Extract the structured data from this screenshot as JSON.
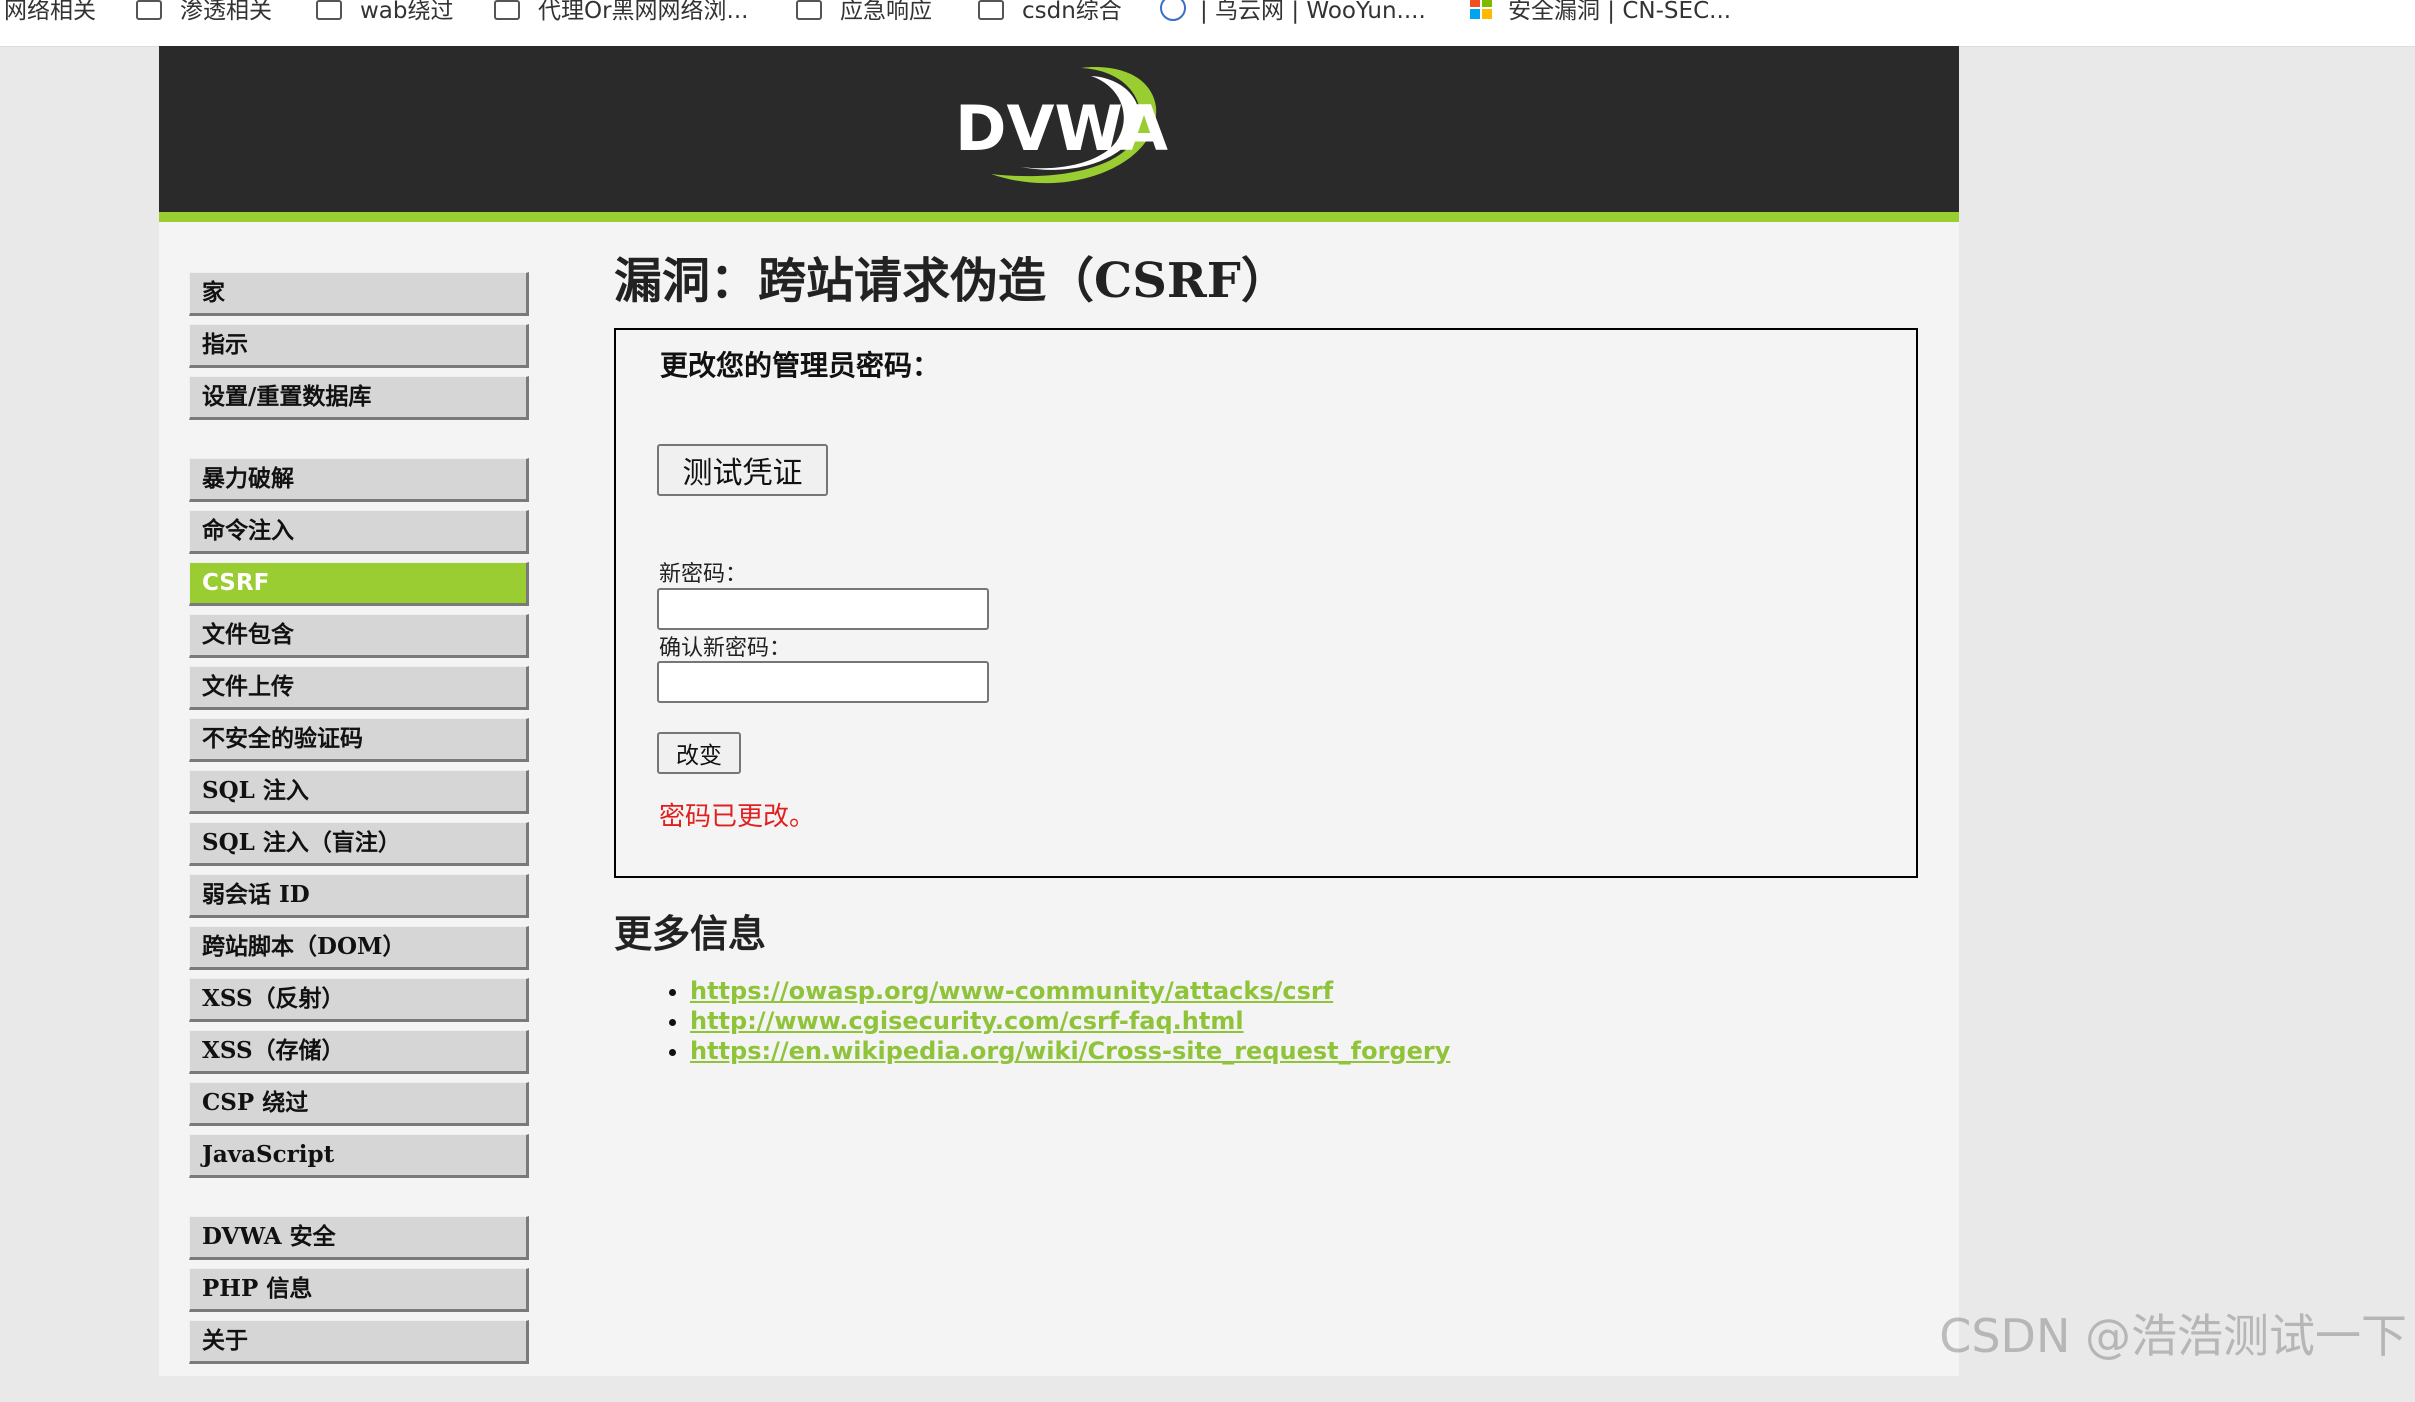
{
  "bookmarks": [
    {
      "label": "网络相关",
      "icon": "none"
    },
    {
      "label": "渗透相关",
      "icon": "folder-icon"
    },
    {
      "label": "wab绕过",
      "icon": "folder-icon"
    },
    {
      "label": "代理Or黑网网络浏...",
      "icon": "folder-icon"
    },
    {
      "label": "应急响应",
      "icon": "folder-icon"
    },
    {
      "label": "csdn综合",
      "icon": "folder-icon"
    },
    {
      "label": "| 乌云网 | WooYun....",
      "icon": "globe-icon"
    },
    {
      "label": "安全漏洞 | CN-SEC...",
      "icon": "grid-icon"
    }
  ],
  "header": {
    "logo_text": "DVWA",
    "accent_color": "#9acd32"
  },
  "menu": {
    "block1": [
      {
        "label": "家"
      },
      {
        "label": "指示"
      },
      {
        "label": "设置/重置数据库"
      }
    ],
    "block2": [
      {
        "label": "暴力破解"
      },
      {
        "label": "命令注入"
      },
      {
        "label": "CSRF",
        "selected": true
      },
      {
        "label": "文件包含"
      },
      {
        "label": "文件上传"
      },
      {
        "label": "不安全的验证码"
      },
      {
        "label": "SQL 注入"
      },
      {
        "label": "SQL 注入（盲注）"
      },
      {
        "label": "弱会话 ID"
      },
      {
        "label": "跨站脚本（DOM）"
      },
      {
        "label": "XSS（反射）"
      },
      {
        "label": "XSS（存储）"
      },
      {
        "label": "CSP 绕过"
      },
      {
        "label": "JavaScript"
      }
    ],
    "block3": [
      {
        "label": "DVWA 安全"
      },
      {
        "label": "PHP 信息"
      },
      {
        "label": "关于"
      }
    ]
  },
  "main": {
    "title": "漏洞：跨站请求伪造（CSRF）",
    "form": {
      "heading": "更改您的管理员密码：",
      "test_button": "测试凭证",
      "new_password_label": "新密码：",
      "new_password_value": "",
      "confirm_password_label": "确认新密码：",
      "confirm_password_value": "",
      "change_button": "改变",
      "message": "密码已更改。",
      "message_color": "#e0201f"
    },
    "more_info": {
      "title": "更多信息",
      "links": [
        "https://owasp.org/www-community/attacks/csrf",
        "http://www.cgisecurity.com/csrf-faq.html",
        "https://en.wikipedia.org/wiki/Cross-site_request_forgery"
      ],
      "link_color": "#8fc43a"
    }
  },
  "watermark": "CSDN @浩浩测试一下"
}
